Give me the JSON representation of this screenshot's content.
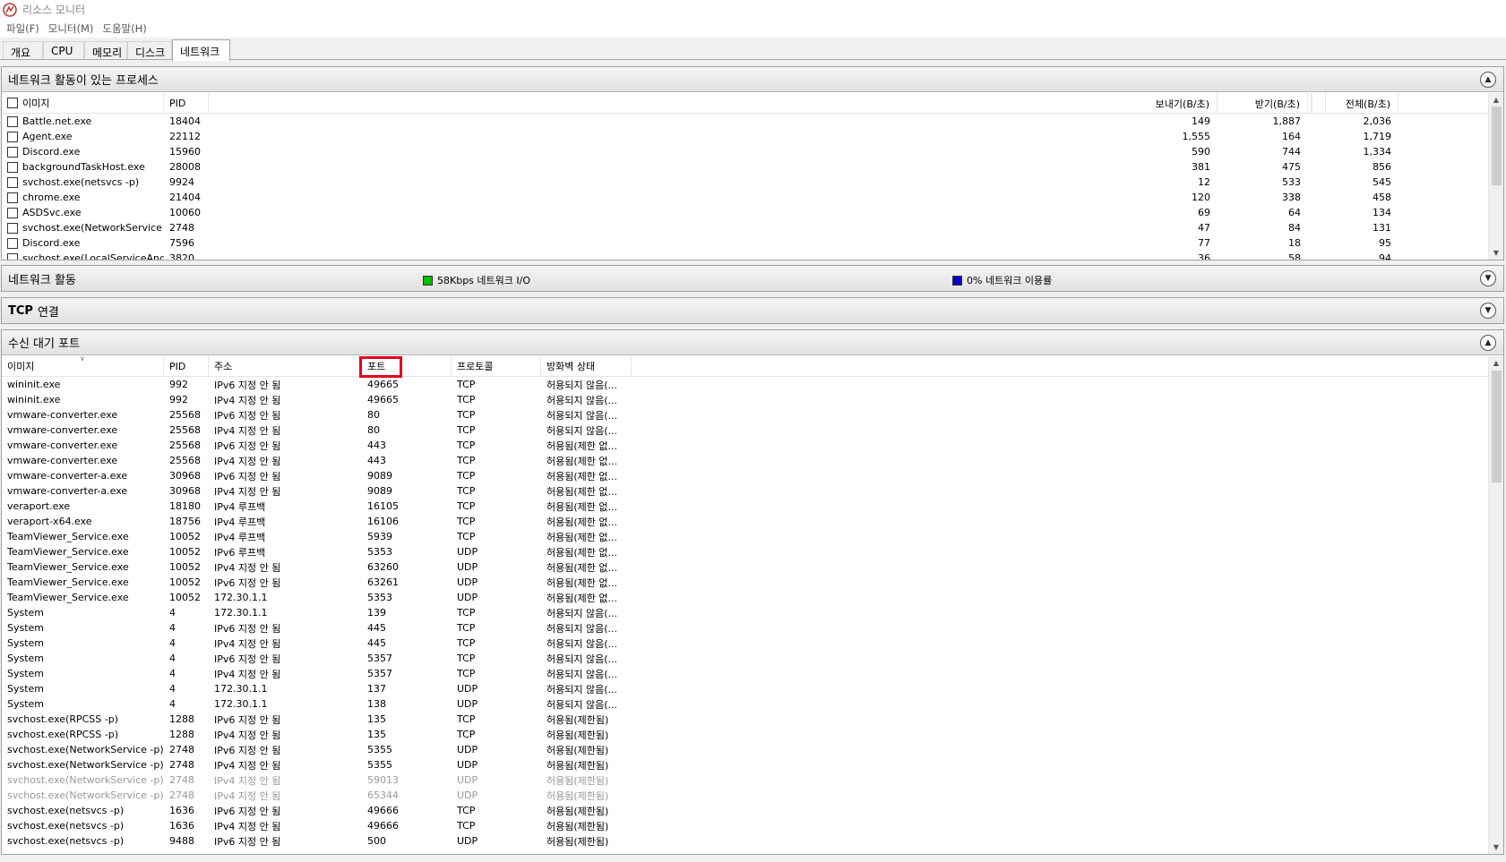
{
  "window": {
    "title": "리소스 모니터"
  },
  "menu": [
    "파일(F)",
    "모니터(M)",
    "도움말(H)"
  ],
  "tabs": [
    {
      "label": "개요",
      "active": false
    },
    {
      "label": "CPU",
      "active": false
    },
    {
      "label": "메모리",
      "active": false
    },
    {
      "label": "디스크",
      "active": false
    },
    {
      "label": "네트워크",
      "active": true
    }
  ],
  "processes_panel": {
    "title": "네트워크 활동이 있는 프로세스",
    "columns": {
      "image": "이미지",
      "pid": "PID",
      "send": "보내기(B/초)",
      "receive": "받기(B/초)",
      "total": "전체(B/초)"
    },
    "rows": [
      {
        "image": "Battle.net.exe",
        "pid": "18404",
        "send": "149",
        "receive": "1,887",
        "total": "2,036"
      },
      {
        "image": "Agent.exe",
        "pid": "22112",
        "send": "1,555",
        "receive": "164",
        "total": "1,719"
      },
      {
        "image": "Discord.exe",
        "pid": "15960",
        "send": "590",
        "receive": "744",
        "total": "1,334"
      },
      {
        "image": "backgroundTaskHost.exe",
        "pid": "28008",
        "send": "381",
        "receive": "475",
        "total": "856"
      },
      {
        "image": "svchost.exe(netsvcs -p)",
        "pid": "9924",
        "send": "12",
        "receive": "533",
        "total": "545"
      },
      {
        "image": "chrome.exe",
        "pid": "21404",
        "send": "120",
        "receive": "338",
        "total": "458"
      },
      {
        "image": "ASDSvc.exe",
        "pid": "10060",
        "send": "69",
        "receive": "64",
        "total": "134"
      },
      {
        "image": "svchost.exe(NetworkService -...",
        "pid": "2748",
        "send": "47",
        "receive": "84",
        "total": "131"
      },
      {
        "image": "Discord.exe",
        "pid": "7596",
        "send": "77",
        "receive": "18",
        "total": "95"
      },
      {
        "image": "svchost.exe(LocalServiceAndN...",
        "pid": "3820",
        "send": "36",
        "receive": "58",
        "total": "94"
      }
    ]
  },
  "network_activity_panel": {
    "title": "네트워크 활동",
    "io_label": "58Kbps 네트워크 I/O",
    "io_color": "#00c000",
    "usage_label": "0% 네트워크 이용률",
    "usage_color": "#0000c8"
  },
  "tcp_panel": {
    "title_bold": "TCP",
    "title_rest": "연결"
  },
  "listening_panel": {
    "title": "수신 대기 포트",
    "columns": {
      "image": "이미지",
      "pid": "PID",
      "address": "주소",
      "port": "포트",
      "protocol": "프로토콜",
      "firewall": "방화벽 상태"
    },
    "rows": [
      {
        "image": "wininit.exe",
        "pid": "992",
        "address": "IPv6 지정 안 됨",
        "port": "49665",
        "protocol": "TCP",
        "firewall": "허용되지 않음(..."
      },
      {
        "image": "wininit.exe",
        "pid": "992",
        "address": "IPv4 지정 안 됨",
        "port": "49665",
        "protocol": "TCP",
        "firewall": "허용되지 않음(..."
      },
      {
        "image": "vmware-converter.exe",
        "pid": "25568",
        "address": "IPv6 지정 안 됨",
        "port": "80",
        "protocol": "TCP",
        "firewall": "허용되지 않음(..."
      },
      {
        "image": "vmware-converter.exe",
        "pid": "25568",
        "address": "IPv4 지정 안 됨",
        "port": "80",
        "protocol": "TCP",
        "firewall": "허용되지 않음(..."
      },
      {
        "image": "vmware-converter.exe",
        "pid": "25568",
        "address": "IPv6 지정 안 됨",
        "port": "443",
        "protocol": "TCP",
        "firewall": "허용됨(제한 없..."
      },
      {
        "image": "vmware-converter.exe",
        "pid": "25568",
        "address": "IPv4 지정 안 됨",
        "port": "443",
        "protocol": "TCP",
        "firewall": "허용됨(제한 없..."
      },
      {
        "image": "vmware-converter-a.exe",
        "pid": "30968",
        "address": "IPv6 지정 안 됨",
        "port": "9089",
        "protocol": "TCP",
        "firewall": "허용됨(제한 없..."
      },
      {
        "image": "vmware-converter-a.exe",
        "pid": "30968",
        "address": "IPv4 지정 안 됨",
        "port": "9089",
        "protocol": "TCP",
        "firewall": "허용됨(제한 없..."
      },
      {
        "image": "veraport.exe",
        "pid": "18180",
        "address": "IPv4 루프백",
        "port": "16105",
        "protocol": "TCP",
        "firewall": "허용됨(제한 없..."
      },
      {
        "image": "veraport-x64.exe",
        "pid": "18756",
        "address": "IPv4 루프백",
        "port": "16106",
        "protocol": "TCP",
        "firewall": "허용됨(제한 없..."
      },
      {
        "image": "TeamViewer_Service.exe",
        "pid": "10052",
        "address": "IPv4 루프백",
        "port": "5939",
        "protocol": "TCP",
        "firewall": "허용됨(제한 없..."
      },
      {
        "image": "TeamViewer_Service.exe",
        "pid": "10052",
        "address": "IPv6 루프백",
        "port": "5353",
        "protocol": "UDP",
        "firewall": "허용됨(제한 없..."
      },
      {
        "image": "TeamViewer_Service.exe",
        "pid": "10052",
        "address": "IPv4 지정 안 됨",
        "port": "63260",
        "protocol": "UDP",
        "firewall": "허용됨(제한 없..."
      },
      {
        "image": "TeamViewer_Service.exe",
        "pid": "10052",
        "address": "IPv6 지정 안 됨",
        "port": "63261",
        "protocol": "UDP",
        "firewall": "허용됨(제한 없..."
      },
      {
        "image": "TeamViewer_Service.exe",
        "pid": "10052",
        "address": "172.30.1.1",
        "port": "5353",
        "protocol": "UDP",
        "firewall": "허용됨(제한 없..."
      },
      {
        "image": "System",
        "pid": "4",
        "address": "172.30.1.1",
        "port": "139",
        "protocol": "TCP",
        "firewall": "허용되지 않음(..."
      },
      {
        "image": "System",
        "pid": "4",
        "address": "IPv6 지정 안 됨",
        "port": "445",
        "protocol": "TCP",
        "firewall": "허용되지 않음(..."
      },
      {
        "image": "System",
        "pid": "4",
        "address": "IPv4 지정 안 됨",
        "port": "445",
        "protocol": "TCP",
        "firewall": "허용되지 않음(..."
      },
      {
        "image": "System",
        "pid": "4",
        "address": "IPv6 지정 안 됨",
        "port": "5357",
        "protocol": "TCP",
        "firewall": "허용되지 않음(..."
      },
      {
        "image": "System",
        "pid": "4",
        "address": "IPv4 지정 안 됨",
        "port": "5357",
        "protocol": "TCP",
        "firewall": "허용되지 않음(..."
      },
      {
        "image": "System",
        "pid": "4",
        "address": "172.30.1.1",
        "port": "137",
        "protocol": "UDP",
        "firewall": "허용되지 않음(..."
      },
      {
        "image": "System",
        "pid": "4",
        "address": "172.30.1.1",
        "port": "138",
        "protocol": "UDP",
        "firewall": "허용되지 않음(..."
      },
      {
        "image": "svchost.exe(RPCSS -p)",
        "pid": "1288",
        "address": "IPv6 지정 안 됨",
        "port": "135",
        "protocol": "TCP",
        "firewall": "허용됨(제한됨)"
      },
      {
        "image": "svchost.exe(RPCSS -p)",
        "pid": "1288",
        "address": "IPv4 지정 안 됨",
        "port": "135",
        "protocol": "TCP",
        "firewall": "허용됨(제한됨)"
      },
      {
        "image": "svchost.exe(NetworkService -p)",
        "pid": "2748",
        "address": "IPv6 지정 안 됨",
        "port": "5355",
        "protocol": "UDP",
        "firewall": "허용됨(제한됨)"
      },
      {
        "image": "svchost.exe(NetworkService -p)",
        "pid": "2748",
        "address": "IPv4 지정 안 됨",
        "port": "5355",
        "protocol": "UDP",
        "firewall": "허용됨(제한됨)"
      },
      {
        "image": "svchost.exe(NetworkService -p)",
        "pid": "2748",
        "address": "IPv4 지정 안 됨",
        "port": "59013",
        "protocol": "UDP",
        "firewall": "허용됨(제한됨)",
        "dim": true
      },
      {
        "image": "svchost.exe(NetworkService -p)",
        "pid": "2748",
        "address": "IPv4 지정 안 됨",
        "port": "65344",
        "protocol": "UDP",
        "firewall": "허용됨(제한됨)",
        "dim": true
      },
      {
        "image": "svchost.exe(netsvcs -p)",
        "pid": "1636",
        "address": "IPv6 지정 안 됨",
        "port": "49666",
        "protocol": "TCP",
        "firewall": "허용됨(제한됨)"
      },
      {
        "image": "svchost.exe(netsvcs -p)",
        "pid": "1636",
        "address": "IPv4 지정 안 됨",
        "port": "49666",
        "protocol": "TCP",
        "firewall": "허용됨(제한됨)"
      },
      {
        "image": "svchost.exe(netsvcs -p)",
        "pid": "9488",
        "address": "IPv6 지정 안 됨",
        "port": "500",
        "protocol": "UDP",
        "firewall": "허용됨(제한됨)"
      }
    ]
  }
}
